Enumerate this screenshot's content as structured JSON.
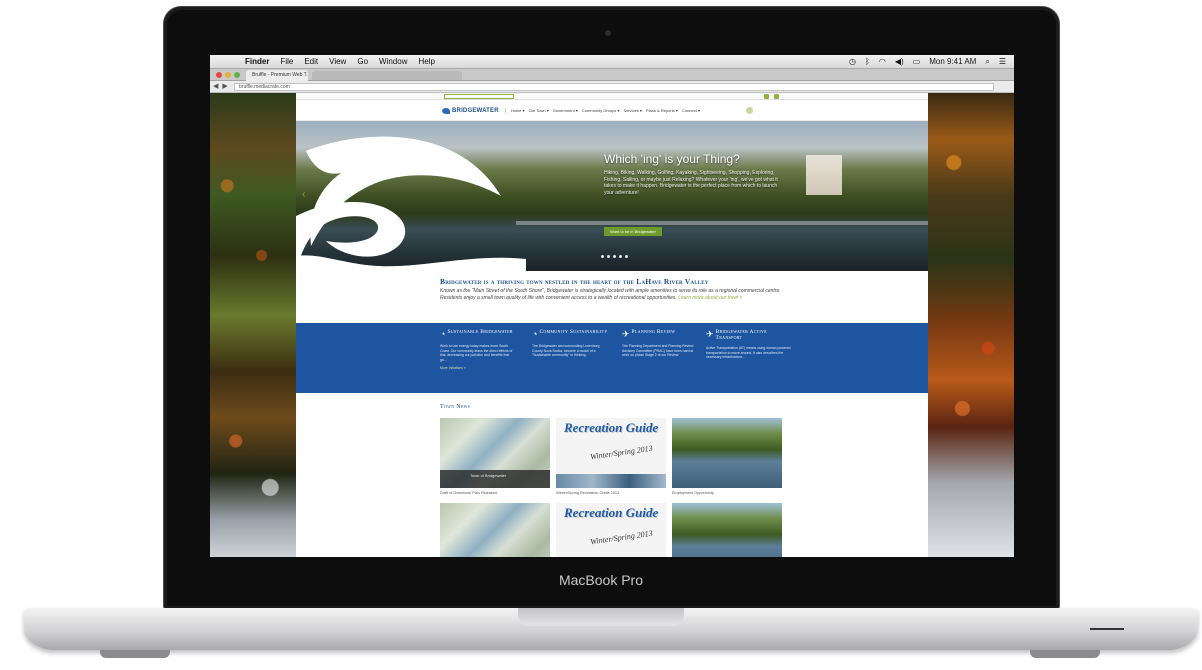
{
  "laptop": {
    "brand": "MacBook Pro"
  },
  "mac_menubar": {
    "apple": "",
    "app": "Finder",
    "menus": [
      "File",
      "Edit",
      "View",
      "Go",
      "Window",
      "Help"
    ],
    "status_icons": [
      "time-machine-icon",
      "bluetooth-icon",
      "wifi-icon",
      "volume-icon",
      "battery-icon"
    ],
    "clock": "Mon 9:41 AM",
    "spotlight": "⌕",
    "list": "☰"
  },
  "browser": {
    "tab_title": "Bruffle - Premium Web T...",
    "url": "bruffle.mediacrate.com",
    "nav": {
      "back": "◀",
      "forward": "▶",
      "reload": "↻"
    },
    "traffic_light_colors": [
      "#e0483e",
      "#e6b23a",
      "#5fb34a"
    ]
  },
  "site": {
    "logo_text": "BRIDGEWATER",
    "nav_items": [
      "Home ▾",
      "Our Town ▾",
      "Government ▾",
      "Community Groups ▾",
      "Services ▾",
      "Plans & Reports ▾",
      "Connect ▾"
    ],
    "hero": {
      "title": "Which 'ing' is your Thing?",
      "text": "Hiking, Biking, Walking, Golfing, Kayaking, Sightseeing, Shopping, Exploring, Fishing, Sailing, or maybe just Relaxing? Whatever your 'ing', we've got what it takes to make it happen. Bridgewater is the perfect place from which to launch your adventure!",
      "button": "Want to be in Bridgewater",
      "prev_arrow": "‹",
      "slide_count": 5
    },
    "intro": {
      "title": "Bridgewater is a thriving town nestled in the heart of the LaHave River Valley",
      "text": "Known as the \"Main Street of the South Shore\", Bridgewater is strategically located with ample amenities to serve its role as a regional commercial centre. Residents enjoy a small town quality of life with convenient access to a wealth of recreational opportunities.",
      "link": "Learn more about our town »"
    },
    "features": [
      {
        "icon": "◔",
        "title": "Sustainable Bridgewater",
        "text": "Work to use energy today makes more South Coast. Our community leans the direct effects of this, decreasing our pollution and benefits that go...",
        "more": "More Initiatives »"
      },
      {
        "icon": "◔",
        "title": "Community Sustainability",
        "text": "The Bridgewater and surrounding Lunenburg County Nova Scotia, become a model of a \"Sustainable community\" in thinking."
      },
      {
        "icon": "✈",
        "title": "Planning Review",
        "text": "The Planning Department and Planning Review Advisory Committee (PRAC) have been hard at work on phase Stage 2 of our Review."
      },
      {
        "icon": "✈",
        "title": "Bridgewater Active Transport",
        "text": "Active Transportation (AT) means using human powered transportation to move around. It also describes the necessary infrastructure..."
      }
    ],
    "news": {
      "title": "Town News",
      "cards": [
        {
          "kind": "map",
          "caption": "Draft of Downtown Plan Released",
          "thumb_label": "Town of Bridgewater"
        },
        {
          "kind": "rec",
          "caption": "Winter/Spring Recreation Guide 2013",
          "thumb_title": "Recreation Guide",
          "thumb_sub": "Winter/Spring 2013"
        },
        {
          "kind": "lake",
          "caption": "Employment Opportunity"
        },
        {
          "kind": "map",
          "caption": "",
          "thumb_label": ""
        },
        {
          "kind": "rec",
          "caption": "",
          "thumb_title": "Recreation Guide",
          "thumb_sub": "Winter/Spring 2013"
        },
        {
          "kind": "lake",
          "caption": ""
        }
      ]
    }
  }
}
